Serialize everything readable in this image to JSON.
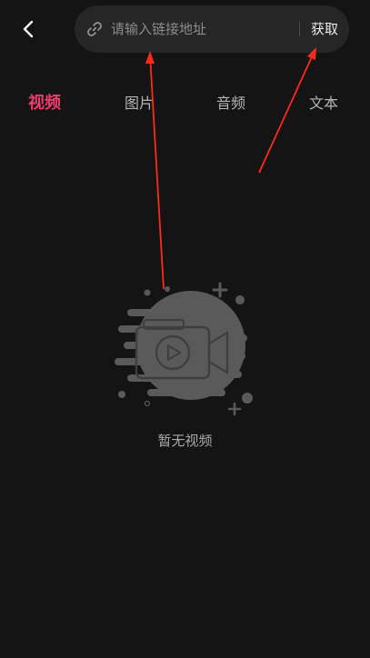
{
  "header": {
    "back_icon": "chevron-left-icon",
    "link_icon": "link-icon",
    "search_placeholder": "请输入链接地址",
    "search_value": "",
    "fetch_label": "获取"
  },
  "tabs": [
    {
      "label": "视频",
      "active": true
    },
    {
      "label": "图片",
      "active": false
    },
    {
      "label": "音频",
      "active": false
    },
    {
      "label": "文本",
      "active": false
    }
  ],
  "empty_state": {
    "icon": "video-camera-icon",
    "message": "暂无视频"
  },
  "colors": {
    "background": "#141414",
    "search_background": "#262626",
    "active_tab": "#ef3c6e",
    "annotation_arrow": "#ff2a1a"
  }
}
